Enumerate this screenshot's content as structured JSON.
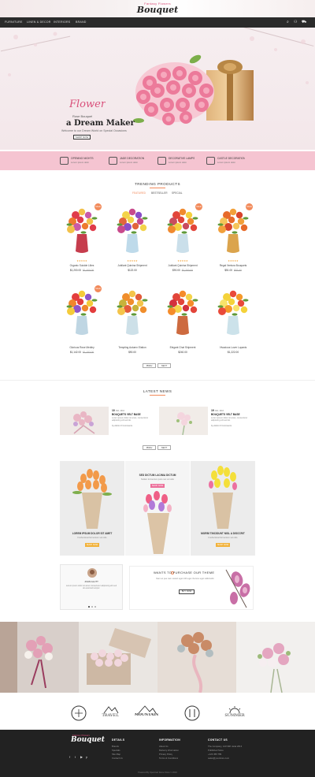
{
  "header": {
    "logo_small": "Fantasy Flowers",
    "logo": "Bouquet"
  },
  "nav": {
    "items": [
      "FURNITURE",
      "LINEN & DECOR",
      "INTERIORS",
      "BRAND"
    ]
  },
  "hero": {
    "script": "Flower",
    "subtitle": "Rose Bouquet",
    "title": "a Dream Maker",
    "desc": "Welcome to our Dream World on Special Occasions",
    "button": "SHOP NOW"
  },
  "features": [
    {
      "t": "OPENING NIGHTS",
      "s": "Lorem ipsum dolor"
    },
    {
      "t": "JADE DECORATION",
      "s": "Lorem ipsum dolor"
    },
    {
      "t": "DECORATIVE LAMPS",
      "s": "Lorem ipsum dolor"
    },
    {
      "t": "CASTLE DECORATION",
      "s": "Lorem ipsum dolor"
    }
  ],
  "products_section": {
    "title": "TRENDING PRODUCTS",
    "tabs": [
      "FEATURED",
      "BESTSELLER",
      "SPECIAL"
    ],
    "prev": "PREV",
    "next": "NEXT"
  },
  "products": [
    {
      "name": "Organic Suicide Lilies",
      "price": "$1,200.00",
      "old": "$1,400.00",
      "badge": "SALE",
      "stars": "★★★★★"
    },
    {
      "name": "Jubilant Quinina Shipment",
      "price": "$122.00",
      "old": "",
      "badge": "",
      "stars": "★★★★★"
    },
    {
      "name": "Jubilant Quinina Shipment",
      "price": "$90.00",
      "old": "$1,200.00",
      "badge": "SALE",
      "stars": "★★★★★"
    },
    {
      "name": "Regal Ventura Bouquets",
      "price": "$51.00",
      "old": "$52.00",
      "badge": "SALE",
      "stars": "★★★★★"
    },
    {
      "name": "Glorious Rose Medley",
      "price": "$1,142.00",
      "old": "$1,152.00",
      "badge": "SALE",
      "stars": "★★★★★"
    },
    {
      "name": "Tempting Autumn Elation",
      "price": "$90.00",
      "old": "",
      "badge": "",
      "stars": "★★★★★"
    },
    {
      "name": "Elegant Chat Shipment",
      "price": "$240.00",
      "old": "",
      "badge": "",
      "stars": "★★★★★"
    },
    {
      "name": "Vivacious Lover Lupanis",
      "price": "$1,222.00",
      "old": "",
      "badge": "",
      "stars": "★★★★★"
    }
  ],
  "news_section": {
    "title": "LATEST NEWS",
    "prev": "PREV",
    "next": "NEXT"
  },
  "news": [
    {
      "date": "10",
      "month": "JAN, 2016",
      "title": "BOUQUETS VELT BASE",
      "desc": "Lorem ipsum dolor sit amet, consectetur adipiscing elit sed do.",
      "meta": "by Admin   0 Comments"
    },
    {
      "date": "19",
      "month": "JAN, 2016",
      "title": "BOUQUETS VELT BASE",
      "desc": "Lorem ipsum dolor sit amet, consectetur adipiscing elit sed do.",
      "meta": "by Admin   0 Comments"
    }
  ],
  "banners": {
    "left": {
      "title": "LOREM IPSUM DOLOR SIT AMET",
      "desc": "Fusha felcat fermentum vel odio",
      "button": "SHOP NOW"
    },
    "center": {
      "title": "SED DICTUM LACINIA DICTUM",
      "desc": "Nullam fermentum justo nec vel odio",
      "button": "SHOP NOW"
    },
    "right": {
      "title": "MORBI TINCIDUNT NISL A DISCCRIT",
      "desc": "Fusha felcat fermentum vel odio",
      "button": "SHOP NOW"
    }
  },
  "testimonial": {
    "name": "JOHN GLUTT",
    "desc": "Lorem ipsum dolor sit amet consectetur adipiscing elit sed do eiusmod tempor."
  },
  "promo": {
    "title": "WANTS TO PURCHASE OUR THEME",
    "desc": "Nam ac pee nam sceleri eget nibh eget rhoncus eget sollicitudin",
    "button": "BUY NOW"
  },
  "brands": [
    "TRAVEL",
    "MOUNTAIN",
    "",
    "SUMMER"
  ],
  "footer": {
    "col1": {
      "title": "DETAILS",
      "items": [
        "Brands",
        "Specials",
        "Site Map",
        "Contact Us"
      ]
    },
    "col2": {
      "title": "INFORMATION",
      "items": [
        "About Us",
        "Delivery Information",
        "Privacy Policy",
        "Terms & Conditions"
      ]
    },
    "col3": {
      "title": "CONTACT US",
      "items": [
        "The Company, 123 NRI Jarat 2013",
        "Published Store",
        "+123 456 789",
        "sales@yourstore.com"
      ]
    },
    "copyright": "Powered By OpenCart Demo Store © 2016"
  },
  "colors": {
    "accent": "#f28a5a",
    "pink": "#f5c4d1",
    "dark": "#2b2b2b",
    "brand_pink": "#d94f7a"
  }
}
